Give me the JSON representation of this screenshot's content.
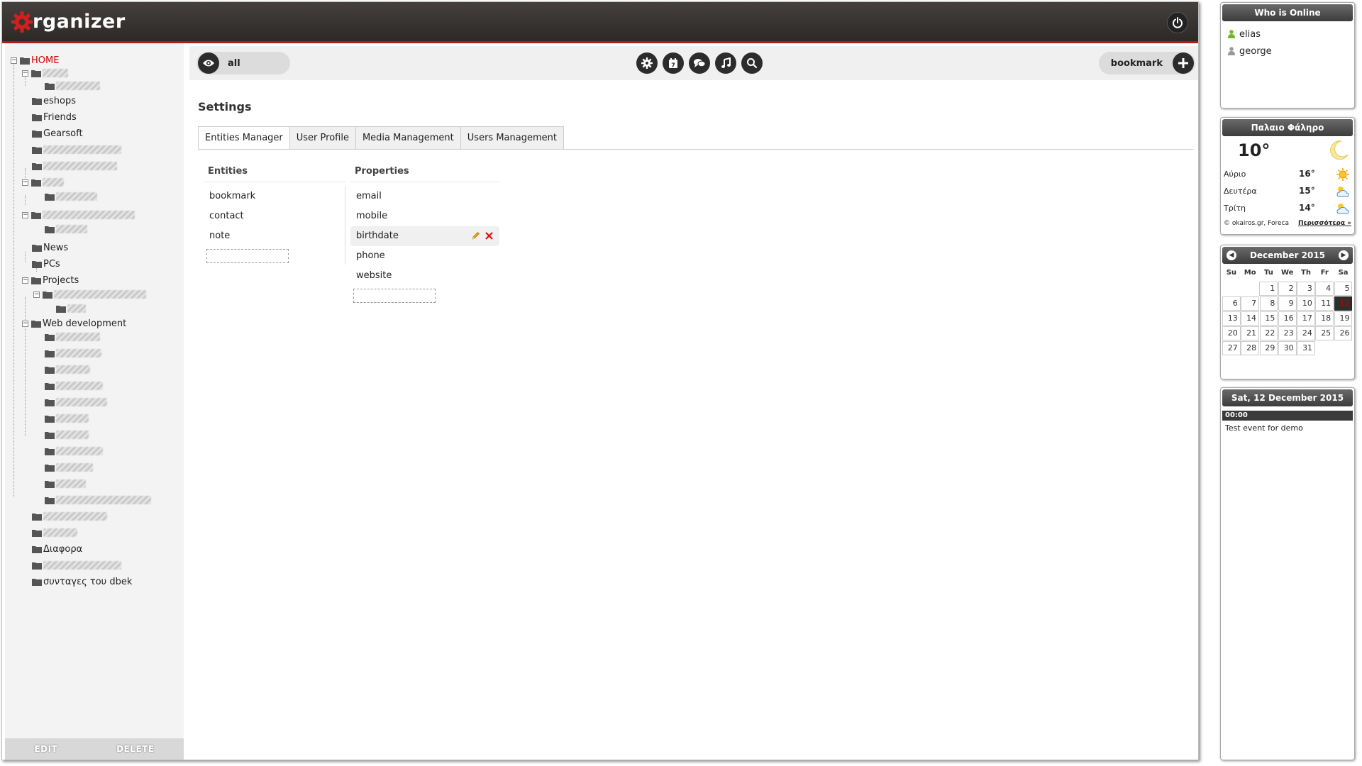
{
  "app": {
    "logo_text": "rganizer"
  },
  "tree": {
    "home": "HOME",
    "items": {
      "eshops": "eshops",
      "friends": "Friends",
      "gearsoft": "Gearsoft",
      "news": "News",
      "pcs": "PCs",
      "projects": "Projects",
      "webdev": "Web development",
      "diafora": "Διαφορα",
      "syntages": "συνταγες του dbek"
    }
  },
  "sidebar_footer": {
    "edit": "EDIT",
    "delete": "DELETE"
  },
  "toolbar": {
    "filter_label": "all",
    "new_label": "bookmark",
    "tools": [
      "settings-icon",
      "calendar-icon",
      "chat-icon",
      "music-icon",
      "search-icon"
    ]
  },
  "settings": {
    "title": "Settings",
    "tabs": [
      "Entities Manager",
      "User Profile",
      "Media Management",
      "Users Management"
    ],
    "active_tab": "Entities Manager",
    "entities_header": "Entities",
    "properties_header": "Properties",
    "entities": [
      "bookmark",
      "contact",
      "note"
    ],
    "properties": [
      "email",
      "mobile",
      "birthdate",
      "phone",
      "website"
    ],
    "selected_property": "birthdate"
  },
  "online": {
    "title": "Who is Online",
    "users": [
      {
        "name": "elias",
        "color": "#6fb82a"
      },
      {
        "name": "george",
        "color": "#999999"
      }
    ]
  },
  "weather": {
    "location": "Παλαιο Φάληρο",
    "current_temp": "10°",
    "forecast": [
      {
        "day": "Αύριο",
        "temp": "16°",
        "icon": "sun-icon"
      },
      {
        "day": "Δευτέρα",
        "temp": "15°",
        "icon": "partly-cloudy-icon"
      },
      {
        "day": "Τρίτη",
        "temp": "14°",
        "icon": "partly-cloudy-icon"
      }
    ],
    "credit": "© okairos.gr, Foreca",
    "more": "Περισσότερα »"
  },
  "calendar": {
    "month_label": "December 2015",
    "weekdays": [
      "Su",
      "Mo",
      "Tu",
      "We",
      "Th",
      "Fr",
      "Sa"
    ],
    "weeks": [
      [
        "",
        "",
        "1",
        "2",
        "3",
        "4",
        "5"
      ],
      [
        "6",
        "7",
        "8",
        "9",
        "10",
        "11",
        "12"
      ],
      [
        "13",
        "14",
        "15",
        "16",
        "17",
        "18",
        "19"
      ],
      [
        "20",
        "21",
        "22",
        "23",
        "24",
        "25",
        "26"
      ],
      [
        "27",
        "28",
        "29",
        "30",
        "31",
        "",
        ""
      ]
    ],
    "today": "12"
  },
  "events": {
    "date_title": "Sat, 12 December 2015",
    "time": "00:00",
    "text": "Test event for demo"
  }
}
